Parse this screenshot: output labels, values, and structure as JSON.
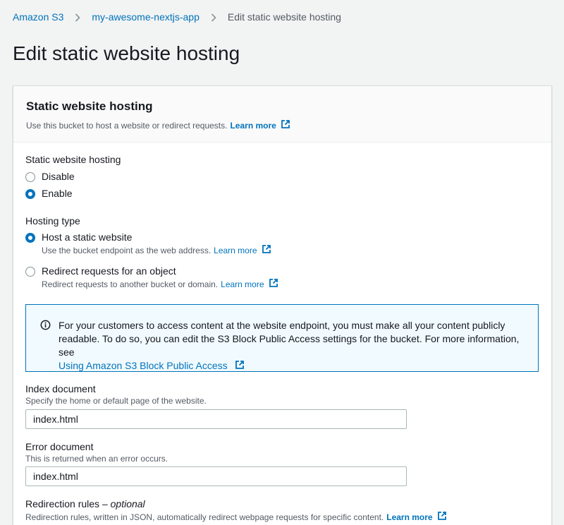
{
  "breadcrumb": {
    "items": [
      "Amazon S3",
      "my-awesome-nextjs-app"
    ],
    "current": "Edit static website hosting"
  },
  "page_title": "Edit static website hosting",
  "card": {
    "title": "Static website hosting",
    "description": "Use this bucket to host a website or redirect requests.",
    "learn_more": "Learn more"
  },
  "hosting": {
    "label": "Static website hosting",
    "options": [
      "Disable",
      "Enable"
    ],
    "selected": "Enable"
  },
  "hosting_type": {
    "label": "Hosting type",
    "options": [
      {
        "label": "Host a static website",
        "description": "Use the bucket endpoint as the web address.",
        "learn_more": "Learn more"
      },
      {
        "label": "Redirect requests for an object",
        "description": "Redirect requests to another bucket or domain.",
        "learn_more": "Learn more"
      }
    ],
    "selected": "Host a static website"
  },
  "info_box": {
    "text": "For your customers to access content at the website endpoint, you must make all your content publicly readable. To do so, you can edit the S3 Block Public Access settings for the bucket. For more information, see",
    "link": "Using Amazon S3 Block Public Access"
  },
  "index_document": {
    "label": "Index document",
    "description": "Specify the home or default page of the website.",
    "value": "index.html"
  },
  "error_document": {
    "label": "Error document",
    "description": "This is returned when an error occurs.",
    "value": "index.html"
  },
  "redirection_rules": {
    "label": "Redirection rules –",
    "optional": "optional",
    "description": "Redirection rules, written in JSON, automatically redirect webpage requests for specific content.",
    "learn_more": "Learn more"
  },
  "colors": {
    "link": "#0073bb",
    "background": "#f2f3f3",
    "info_bg": "#f1faff"
  },
  "icons": [
    "chevron-right-icon",
    "external-link-icon",
    "info-icon"
  ]
}
